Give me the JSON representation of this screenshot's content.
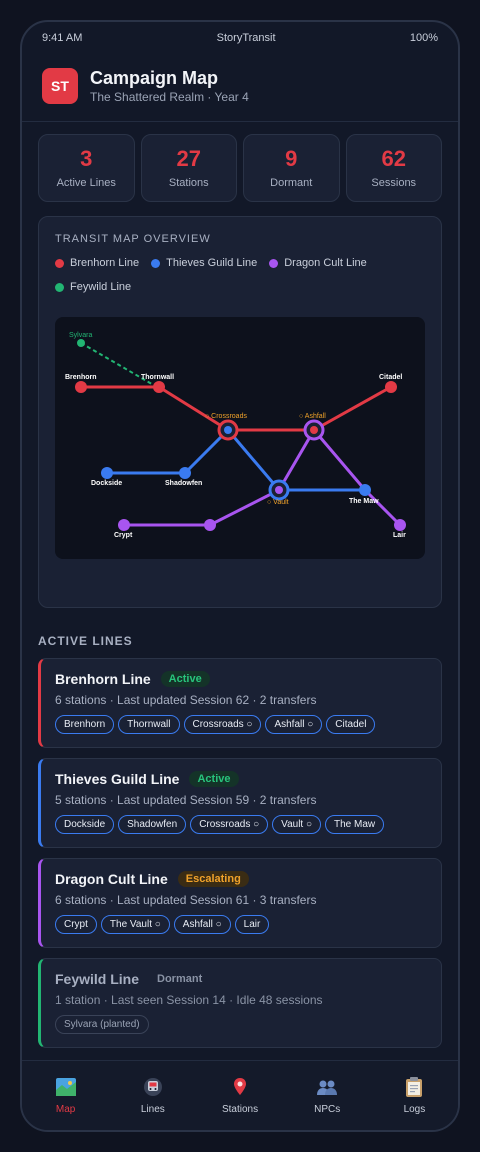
{
  "status_bar": {
    "time": "9:41 AM",
    "carrier": "StoryTransit",
    "battery": "100%"
  },
  "header": {
    "logo": "ST",
    "title": "Campaign Map",
    "subtitle": "The Shattered Realm · Year 4"
  },
  "stats": [
    {
      "value": "3",
      "label": "Active Lines"
    },
    {
      "value": "27",
      "label": "Stations"
    },
    {
      "value": "9",
      "label": "Dormant"
    },
    {
      "value": "62",
      "label": "Sessions"
    }
  ],
  "map": {
    "title": "TRANSIT MAP OVERVIEW",
    "legend": [
      {
        "label": "Brenhorn Line",
        "color": "#e23a45"
      },
      {
        "label": "Thieves Guild Line",
        "color": "#3a7bf0"
      },
      {
        "label": "Dragon Cult Line",
        "color": "#a855f0"
      },
      {
        "label": "Feywild Line",
        "color": "#22b573"
      }
    ],
    "labels": {
      "sylvara": "Sylvara",
      "brenhorn": "Brenhorn",
      "thornwall": "Thornwall",
      "citadel": "Citadel",
      "crossroads": "○ Crossroads",
      "ashfall": "○ Ashfall",
      "dockside": "Dockside",
      "shadowfen": "Shadowfen",
      "vault": "○ Vault",
      "the_maw": "The Maw",
      "crypt": "Crypt",
      "lair": "Lair"
    }
  },
  "section_title": "ACTIVE LINES",
  "lines": [
    {
      "name": "Brenhorn Line",
      "status": "Active",
      "color": "#e23a45",
      "meta": "6 stations · Last updated Session 62 · 2 transfers",
      "stations": [
        "Brenhorn",
        "Thornwall",
        "Crossroads ○",
        "Ashfall ○",
        "Citadel"
      ]
    },
    {
      "name": "Thieves Guild Line",
      "status": "Active",
      "color": "#3a7bf0",
      "meta": "5 stations · Last updated Session 59 · 2 transfers",
      "stations": [
        "Dockside",
        "Shadowfen",
        "Crossroads ○",
        "Vault ○",
        "The Maw"
      ]
    },
    {
      "name": "Dragon Cult Line",
      "status": "Escalating",
      "color": "#a855f0",
      "meta": "6 stations · Last updated Session 61 · 3 transfers",
      "stations": [
        "Crypt",
        "The Vault ○",
        "Ashfall ○",
        "Lair"
      ]
    },
    {
      "name": "Feywild Line",
      "status": "Dormant",
      "color": "#22b573",
      "meta": "1 station · Last seen Session 14 · Idle 48 sessions",
      "stations": [
        "Sylvara (planted)"
      ]
    }
  ],
  "tabs": [
    {
      "label": "Map",
      "icon": "map-icon",
      "active": true
    },
    {
      "label": "Lines",
      "icon": "train-icon",
      "active": false
    },
    {
      "label": "Stations",
      "icon": "pin-icon",
      "active": false
    },
    {
      "label": "NPCs",
      "icon": "people-icon",
      "active": false
    },
    {
      "label": "Logs",
      "icon": "clipboard-icon",
      "active": false
    }
  ]
}
